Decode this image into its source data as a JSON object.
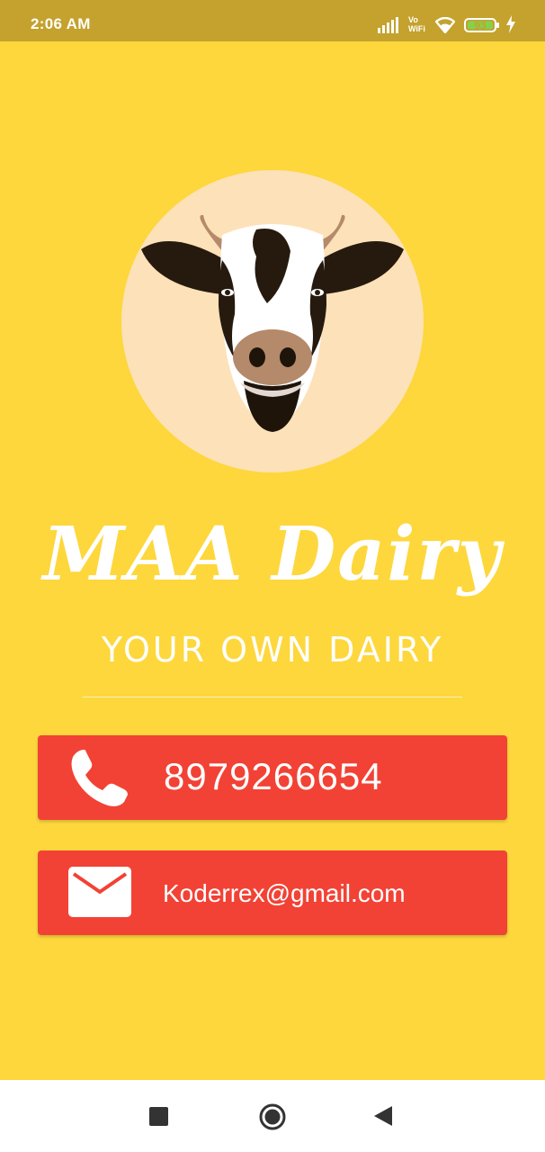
{
  "status_bar": {
    "time": "2:06 AM",
    "network_label_top": "Vo",
    "network_label_bottom": "WiFi",
    "battery_level": "93",
    "icons": [
      "signal-icon",
      "vowifi-icon",
      "wifi-icon",
      "battery-icon",
      "charging-icon"
    ]
  },
  "logo": {
    "icon": "cow-head-icon"
  },
  "brand": {
    "name": "MAA Dairy"
  },
  "tagline": "YOUR OWN DAIRY",
  "contacts": {
    "phone": {
      "icon": "phone-icon",
      "label": "8979266654"
    },
    "email": {
      "icon": "mail-icon",
      "label": "Koderrex@gmail.com"
    }
  },
  "nav_bar": {
    "icons": [
      "recent-apps-icon",
      "home-icon",
      "back-icon"
    ]
  },
  "colors": {
    "background": "#FDD73C",
    "status_bar": "#C4A22D",
    "button": "#F24235",
    "logo_circle": "#FDE1B8",
    "text": "#FFFFFF"
  }
}
